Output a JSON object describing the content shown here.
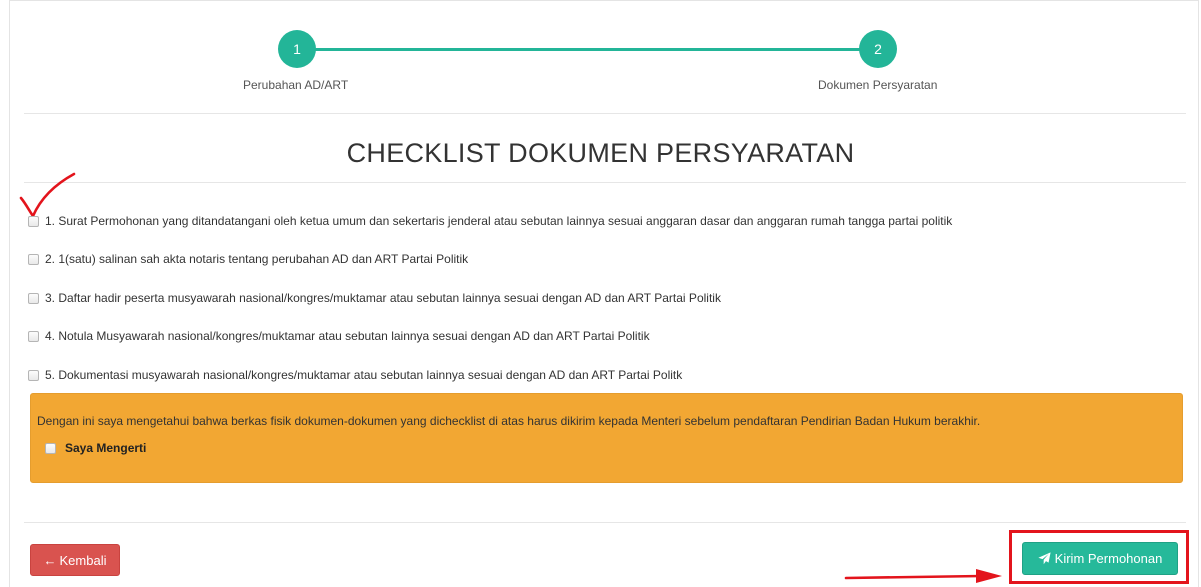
{
  "stepper": {
    "steps": [
      {
        "number": "1",
        "label": "Perubahan AD/ART"
      },
      {
        "number": "2",
        "label": "Dokumen Persyaratan"
      }
    ],
    "color": "#23b598"
  },
  "page_title": "CHECKLIST DOKUMEN PERSYARATAN",
  "checklist": {
    "items": [
      {
        "label": "1. Surat Permohonan yang ditandatangani oleh ketua umum dan sekertaris jenderal atau sebutan lainnya sesuai anggaran dasar dan anggaran rumah tangga partai politik",
        "checked": false
      },
      {
        "label": "2. 1(satu) salinan sah akta notaris tentang perubahan AD dan ART Partai Politik",
        "checked": false
      },
      {
        "label": "3. Daftar hadir peserta musyawarah nasional/kongres/muktamar atau sebutan lainnya sesuai dengan AD dan ART Partai Politik",
        "checked": false
      },
      {
        "label": "4. Notula Musyawarah nasional/kongres/muktamar atau sebutan lainnya sesuai dengan AD dan ART Partai Politik",
        "checked": false
      },
      {
        "label": "5. Dokumentasi musyawarah nasional/kongres/muktamar atau sebutan lainnya sesuai dengan AD dan ART Partai Politk",
        "checked": false
      }
    ]
  },
  "notice": {
    "text": "Dengan ini saya mengetahui bahwa berkas fisik dokumen-dokumen yang dichecklist di atas harus dikirim kepada Menteri sebelum pendaftaran Pendirian Badan Hukum berakhir.",
    "agree_label": "Saya Mengerti",
    "background": "#f2a733"
  },
  "buttons": {
    "back_label": "Kembali",
    "back_icon": "arrow-left-icon",
    "back_color": "#d9534f",
    "send_label": "Kirim Permohonan",
    "send_icon": "paper-plane-icon",
    "send_color": "#26b99a"
  },
  "annotations": {
    "color": "#e3141c",
    "check_mark": "check-mark-annotation",
    "arrow": "arrow-right-annotation",
    "highlight": "highlight-box-annotation"
  }
}
